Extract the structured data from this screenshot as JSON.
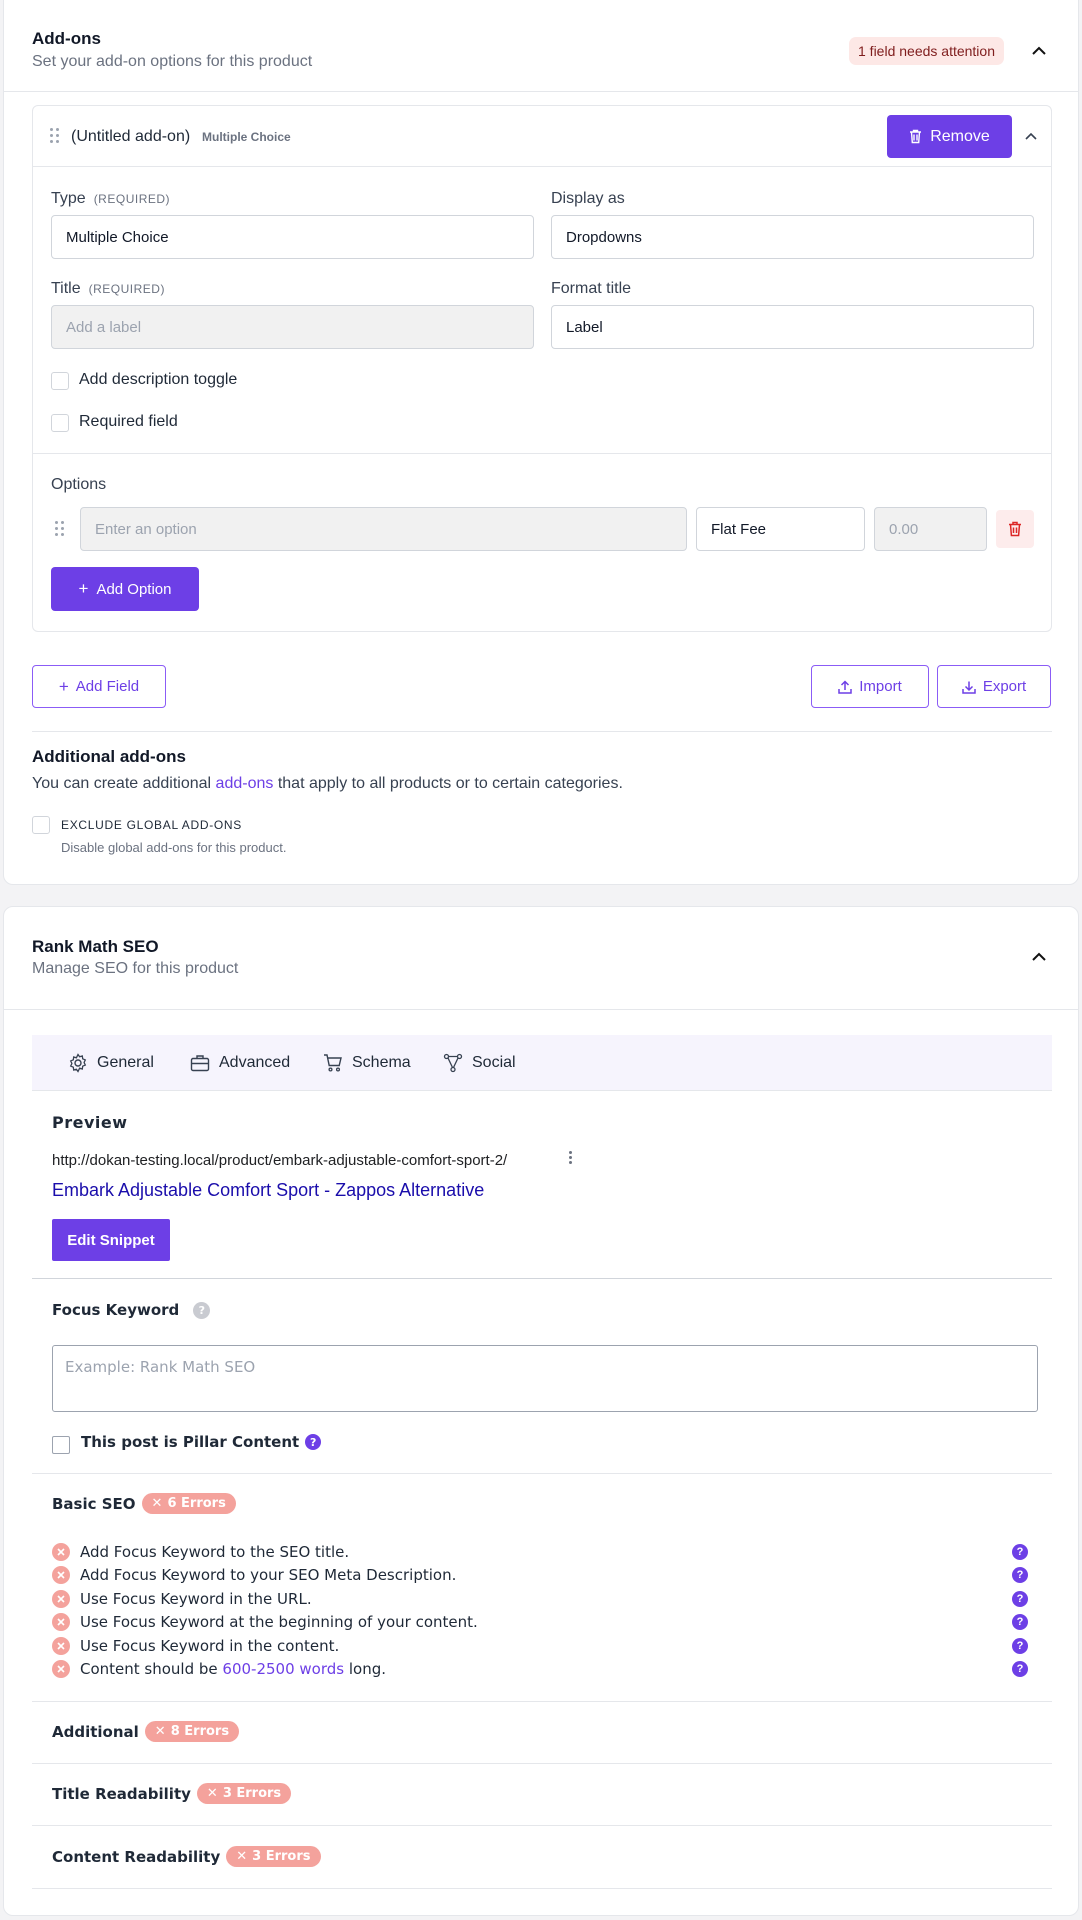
{
  "addons": {
    "title": "Add-ons",
    "subtitle": "Set your add-on options for this product",
    "attention_badge": "1 field needs attention",
    "addon": {
      "name": "(Untitled add-on)",
      "type_tag": "Multiple Choice",
      "remove_label": "Remove",
      "type_label": "Type",
      "required_tag": "(REQUIRED)",
      "type_value": "Multiple Choice",
      "display_label": "Display as",
      "display_value": "Dropdowns",
      "title_label": "Title",
      "title_required_tag": "(REQUIRED)",
      "title_placeholder": "Add a label",
      "format_label": "Format title",
      "format_value": "Label",
      "desc_toggle_label": "Add description toggle",
      "required_field_label": "Required field",
      "options_label": "Options",
      "option_placeholder": "Enter an option",
      "fee_value": "Flat Fee",
      "price_placeholder": "0.00",
      "add_option_label": "Add Option"
    },
    "add_field_label": "Add Field",
    "import_label": "Import",
    "export_label": "Export",
    "additional_title": "Additional add-ons",
    "additional_text_before": "You can create additional ",
    "additional_link": "add-ons",
    "additional_text_after": " that apply to all products or to certain categories.",
    "exclude_label": "EXCLUDE GLOBAL ADD-ONS",
    "exclude_desc": "Disable global add-ons for this product."
  },
  "seo": {
    "title": "Rank Math SEO",
    "subtitle": "Manage SEO for this product",
    "tabs": [
      {
        "label": "General",
        "icon": "gear-icon"
      },
      {
        "label": "Advanced",
        "icon": "briefcase-icon"
      },
      {
        "label": "Schema",
        "icon": "cart-icon"
      },
      {
        "label": "Social",
        "icon": "share-icon"
      }
    ],
    "preview_label": "Preview",
    "preview_url": "http://dokan-testing.local/product/embark-adjustable-comfort-sport-2/",
    "preview_title": "Embark Adjustable Comfort Sport - Zappos Alternative",
    "edit_snippet_label": "Edit Snippet",
    "focus_keyword_label": "Focus Keyword",
    "focus_keyword_placeholder": "Example: Rank Math SEO",
    "pillar_label": "This post is Pillar Content",
    "basic_seo_label": "Basic SEO",
    "basic_seo_errors": "6 Errors",
    "checks": [
      "Add Focus Keyword to the SEO title.",
      "Add Focus Keyword to your SEO Meta Description.",
      "Use Focus Keyword in the URL.",
      "Use Focus Keyword at the beginning of your content.",
      "Use Focus Keyword in the content."
    ],
    "content_length_before": "Content should be ",
    "content_length_link": "600-2500 words",
    "content_length_after": " long.",
    "additional_label": "Additional",
    "additional_errors": "8 Errors",
    "title_readability_label": "Title Readability",
    "title_readability_errors": "3 Errors",
    "content_readability_label": "Content Readability",
    "content_readability_errors": "3 Errors"
  },
  "colors": {
    "accent": "#6d3fe6",
    "error_pill": "#f4a29c",
    "attention_bg": "#fde8e6",
    "link_blue": "#1a0dab"
  }
}
